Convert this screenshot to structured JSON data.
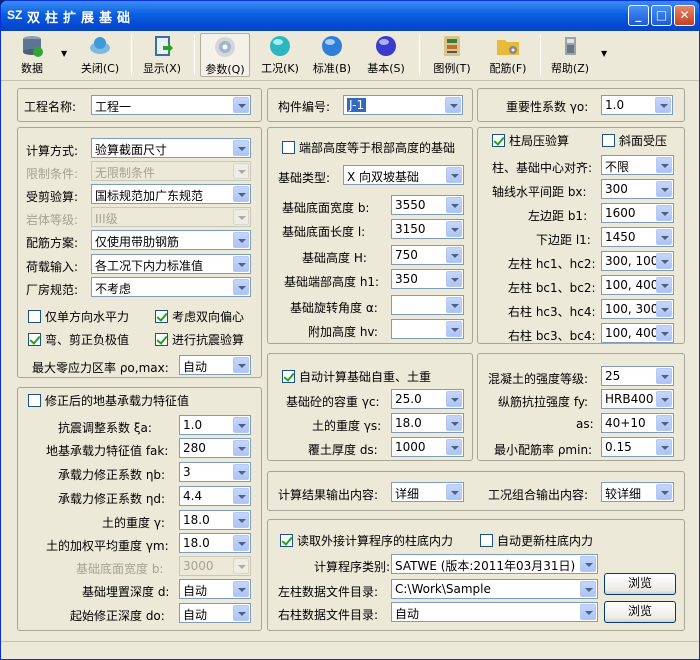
{
  "window": {
    "app_icon": "SZ",
    "title": "双柱扩展基础"
  },
  "toolbar": {
    "data": "数据",
    "close": "关闭(C)",
    "display": "显示(X)",
    "params": "参数(Q)",
    "cases": "工况(K)",
    "standard": "标准(B)",
    "basic": "基本(S)",
    "legend": "图例(T)",
    "rebar": "配筋(F)",
    "help": "帮助(Z)"
  },
  "top": {
    "project_label": "工程名称:",
    "project_value": "工程一",
    "member_label": "构件编号:",
    "member_value": "J-1",
    "importance_label": "重要性系数 γo:",
    "importance_value": "1.0"
  },
  "calc": {
    "method_label": "计算方式:",
    "method_value": "验算截面尺寸",
    "limit_label": "限制条件:",
    "limit_value": "无限制条件",
    "shear_label": "受剪验算:",
    "shear_value": "国标规范加广东规范",
    "rock_label": "岩体等级:",
    "rock_value": "III级",
    "rebar_label": "配筋方案:",
    "rebar_value": "仅使用带肋钢筋",
    "load_label": "荷载输入:",
    "load_value": "各工况下内力标准值",
    "plant_label": "厂房规范:",
    "plant_value": "不考虑",
    "cb_single": "仅单方向水平力",
    "cb_biaxial": "考虑双向偏心",
    "cb_bend": "弯、剪正负极值",
    "cb_seismic": "进行抗震验算",
    "zero_label": "最大零应力区率 ρo,max:",
    "zero_value": "自动"
  },
  "geom": {
    "cb_height": "端部高度等于根部高度的基础",
    "type_label": "基础类型:",
    "type_value": "X 向双坡基础",
    "width_label": "基础底面宽度 b:",
    "width_value": "3550",
    "length_label": "基础底面长度 l:",
    "length_value": "3150",
    "height_label": "基础高度 H:",
    "height_value": "750",
    "end_label": "基础端部高度 h1:",
    "end_value": "350",
    "angle_label": "基础旋转角度 α:",
    "angle_value": "",
    "add_label": "附加高度 hv:",
    "add_value": ""
  },
  "column": {
    "cb_local": "柱局压验算",
    "cb_slope": "斜面受压",
    "align_label": "柱、基础中心对齐:",
    "align_value": "不限",
    "axis_label": "轴线水平间距 bx:",
    "axis_value": "300",
    "left_label": "左边距 b1:",
    "left_value": "1600",
    "bottom_label": "下边距 l1:",
    "bottom_value": "1450",
    "lt_label": "左柱 hc1、hc2:",
    "lt_value": "300, 100",
    "lb_label": "左柱 bc1、bc2:",
    "lb_value": "100, 400",
    "rt_label": "右柱 hc3、hc4:",
    "rt_value": "100, 300",
    "rb_label": "右柱 bc3、bc4:",
    "rb_value": "100, 400"
  },
  "selfw": {
    "cb_auto": "自动计算基础自重、土重",
    "conc_label": "基础砼的容重 γc:",
    "conc_value": "25.0",
    "soil_label": "土的重度 γs:",
    "soil_value": "18.0",
    "cover_label": "覆土厚度 ds:",
    "cover_value": "1000"
  },
  "material": {
    "grade_label": "混凝土的强度等级:",
    "grade_value": "25",
    "steel_label": "纵筋抗拉强度 fy:",
    "steel_value": "HRB400",
    "as_label": "as:",
    "as_value": "40+10",
    "rho_label": "最小配筋率 ρmin:",
    "rho_value": "0.15"
  },
  "bearing": {
    "cb_title": "修正后的地基承载力特征值",
    "seis_label": "抗震调整系数 ξa:",
    "seis_value": "1.0",
    "fak_label": "地基承载力特征值 fak:",
    "fak_value": "280",
    "nb_label": "承载力修正系数 ηb:",
    "nb_value": "3",
    "nd_label": "承载力修正系数 ηd:",
    "nd_value": "4.4",
    "gamma_label": "土的重度 γ:",
    "gamma_value": "18.0",
    "gm_label": "土的加权平均重度 γm:",
    "gm_value": "18.0",
    "corr_label": "基础底面宽度 b:",
    "corr_value": "3000",
    "depth_label": "基础埋置深度 d:",
    "depth_value": "自动",
    "start_label": "起始修正深度 do:",
    "start_value": "自动"
  },
  "output": {
    "result_label": "计算结果输出内容:",
    "result_value": "详细",
    "combo_label": "工况组合输出内容:",
    "combo_value": "较详细"
  },
  "external": {
    "cb_read": "读取外接计算程序的柱底内力",
    "cb_update": "自动更新柱底内力",
    "prog_label": "计算程序类别:",
    "prog_value": "SATWE (版本:2011年03月31日)",
    "left_label": "左柱数据文件目录:",
    "left_value": "C:\\Work\\Sample",
    "right_label": "右柱数据文件目录:",
    "right_value": "自动",
    "browse": "浏览"
  }
}
